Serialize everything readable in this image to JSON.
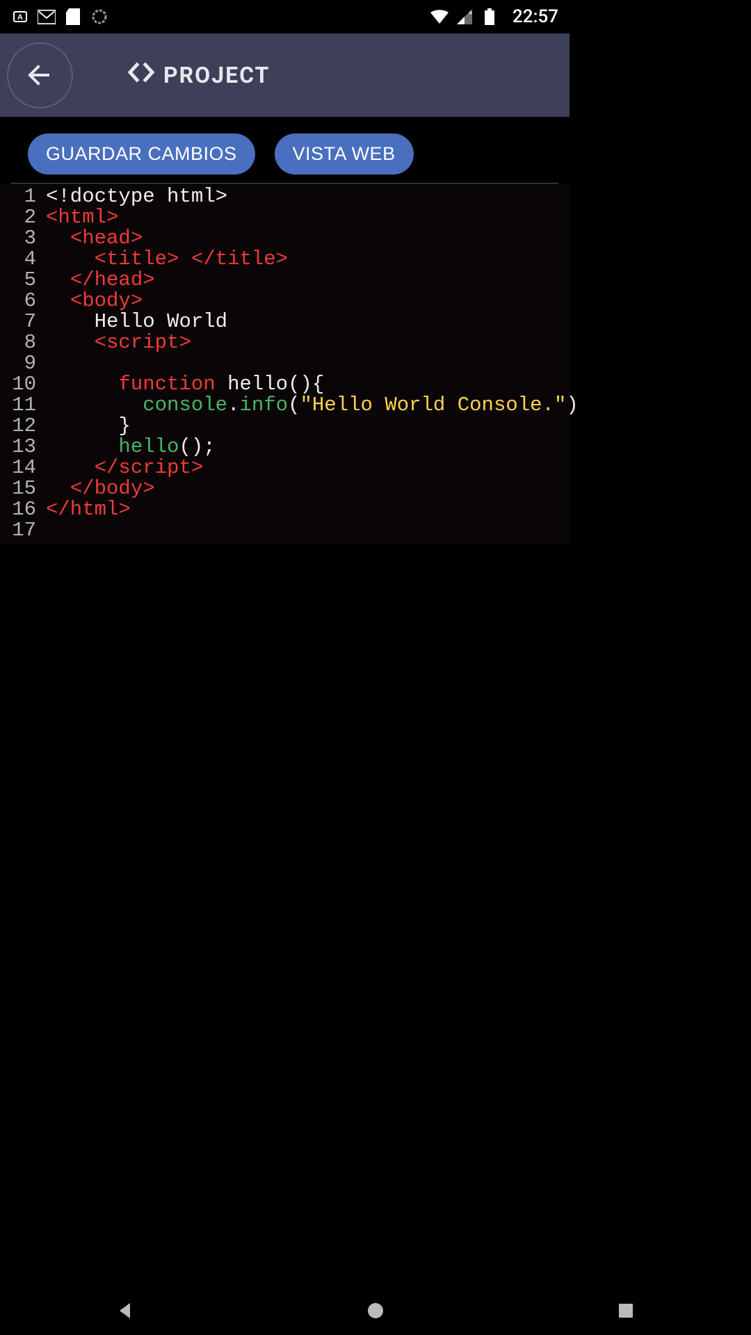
{
  "status": {
    "time": "22:57"
  },
  "header": {
    "title": "PROJECT"
  },
  "actions": {
    "save": "GUARDAR CAMBIOS",
    "webview": "VISTA WEB"
  },
  "code": {
    "lines": [
      "1",
      "2",
      "3",
      "4",
      "5",
      "6",
      "7",
      "8",
      "9",
      "10",
      "11",
      "12",
      "13",
      "14",
      "15",
      "16",
      "17"
    ],
    "l1": "<!doctype html>",
    "l2": "<html>",
    "l3_indent": "  ",
    "l3": "<head>",
    "l4_indent": "    ",
    "l4_open": "<title>",
    "l4_mid": " ",
    "l4_close": "</title>",
    "l5_indent": "  ",
    "l5": "</head>",
    "l6_indent": "  ",
    "l6": "<body>",
    "l7_indent": "    ",
    "l7": "Hello World",
    "l8_indent": "    ",
    "l8": "<script>",
    "l9": "",
    "l10_indent": "      ",
    "l10_kw": "function",
    "l10_sp": " ",
    "l10_name": "hello",
    "l10_rest": "(){",
    "l11_indent": "        ",
    "l11_obj": "console",
    "l11_dot": ".",
    "l11_prop": "info",
    "l11_open": "(",
    "l11_str": "\"Hello World Console.\"",
    "l11_close": ")",
    "l12_indent": "      ",
    "l12": "}",
    "l13_indent": "      ",
    "l13_name": "hello",
    "l13_rest": "();",
    "l14_indent": "    ",
    "l14": "</script>",
    "l15_indent": "  ",
    "l15": "</body>",
    "l16": "</html>",
    "l17": ""
  }
}
